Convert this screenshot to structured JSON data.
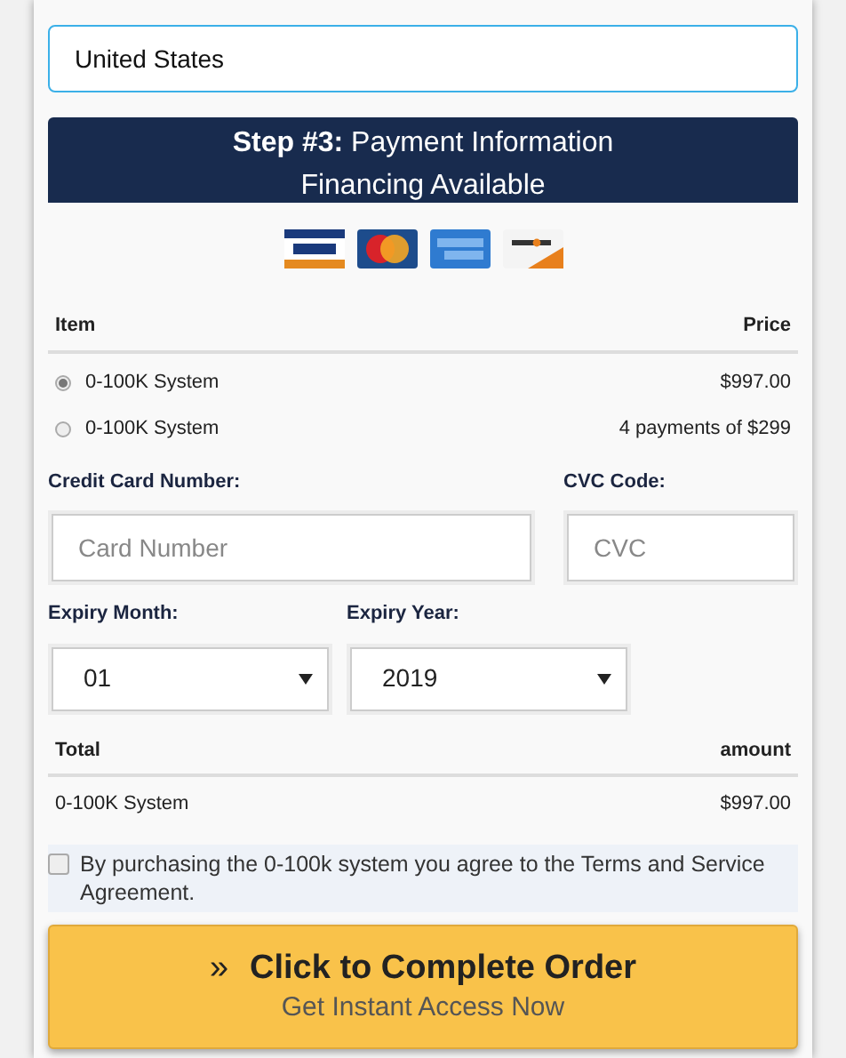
{
  "country_field": {
    "value": "United States"
  },
  "header": {
    "title": "**Step #3:** Payment Information",
    "subtitle": "Financing Available"
  },
  "items_table": {
    "columns": [
      "Item",
      "Price"
    ],
    "rows": [
      {
        "label": "0-100K System",
        "price": "$997.00",
        "selected": true
      },
      {
        "label": "0-100K System",
        "price": "4 payments of $299",
        "selected": false
      }
    ]
  },
  "card_number": {
    "label": "Credit Card Number:",
    "placeholder": "Card Number"
  },
  "cvc": {
    "label": "CVC Code:",
    "placeholder": "CVC"
  },
  "expiry_month": {
    "label": "Expiry Month:",
    "value": "01"
  },
  "expiry_year": {
    "label": "Expiry Year:",
    "value": "2019"
  },
  "summary": {
    "columns": [
      "Total",
      "amount"
    ],
    "rows": [
      {
        "item": "0-100K System",
        "amount": "$997.00"
      }
    ]
  },
  "agreement": {
    "checked": false,
    "text": "By purchasing the 0-100k system you agree to the Terms and Service Agreement."
  },
  "order_button": {
    "icon": "»",
    "title": "Click to Complete Order",
    "subtitle": "Get Instant Access Now"
  }
}
